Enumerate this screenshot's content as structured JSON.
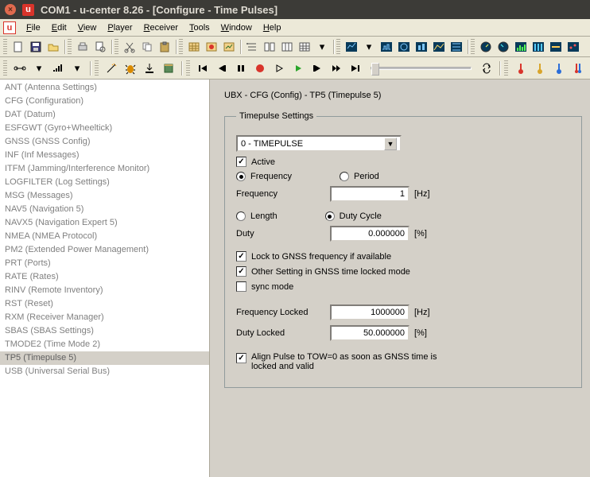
{
  "title": "COM1 - u-center 8.26 - [Configure - Time Pulses]",
  "app_letter": "u",
  "menu": [
    "File",
    "Edit",
    "View",
    "Player",
    "Receiver",
    "Tools",
    "Window",
    "Help"
  ],
  "sidebar": {
    "items": [
      "ANT (Antenna Settings)",
      "CFG (Configuration)",
      "DAT (Datum)",
      "ESFGWT (Gyro+Wheeltick)",
      "GNSS (GNSS Config)",
      "INF (Inf Messages)",
      "ITFM (Jamming/Interference Monitor)",
      "LOGFILTER (Log Settings)",
      "MSG (Messages)",
      "NAV5 (Navigation 5)",
      "NAVX5 (Navigation Expert 5)",
      "NMEA (NMEA Protocol)",
      "PM2 (Extended Power Management)",
      "PRT (Ports)",
      "RATE (Rates)",
      "RINV (Remote Inventory)",
      "RST (Reset)",
      "RXM (Receiver Manager)",
      "SBAS (SBAS Settings)",
      "TMODE2 (Time Mode 2)",
      "TP5 (Timepulse 5)",
      "USB (Universal Serial Bus)"
    ],
    "selected_index": 20
  },
  "content": {
    "breadcrumb": "UBX - CFG (Config) - TP5 (Timepulse 5)",
    "groupbox": "Timepulse Settings",
    "dropdown_value": "0 - TIMEPULSE",
    "active_label": "Active",
    "active_checked": true,
    "mode_freq_label": "Frequency",
    "mode_period_label": "Period",
    "mode_selected": "Frequency",
    "freq_label": "Frequency",
    "freq_value": "1",
    "freq_unit": "[Hz]",
    "len_label": "Length",
    "duty_label_radio": "Duty Cycle",
    "len_duty_selected": "Duty Cycle",
    "duty_label": "Duty",
    "duty_value": "0.000000",
    "duty_unit": "[%]",
    "lock_gnss_label": "Lock to GNSS frequency if available",
    "lock_gnss_checked": true,
    "other_setting_label": "Other Setting in GNSS time locked mode",
    "other_setting_checked": true,
    "sync_mode_label": "sync mode",
    "sync_mode_checked": false,
    "freq_locked_label": "Frequency Locked",
    "freq_locked_value": "1000000",
    "freq_locked_unit": "[Hz]",
    "duty_locked_label": "Duty Locked",
    "duty_locked_value": "50.000000",
    "duty_locked_unit": "[%]",
    "align_pulse_label": "Align Pulse to TOW=0 as soon as GNSS time is locked and valid",
    "align_pulse_checked": true
  }
}
